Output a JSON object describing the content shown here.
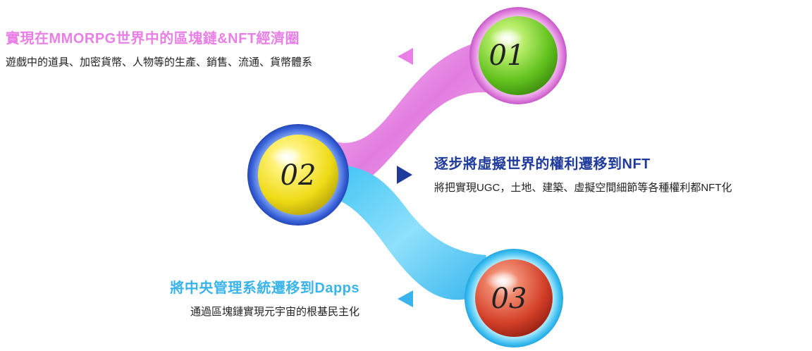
{
  "colors": {
    "pink": "#e97fe6",
    "navy": "#1e3a9c",
    "cyan": "#3ab4ec",
    "green": "#6ecb2a",
    "yellow": "#f2e21c",
    "red": "#d8402c"
  },
  "steps": [
    {
      "number": "01",
      "title": "實現在MMORPG世界中的區塊鏈&NFT經濟圈",
      "description": "遊戲中的道具、加密貨幣、人物等的生產、銷售、流通、貨幣體系"
    },
    {
      "number": "02",
      "title": "逐步將虛擬世界的權利遷移到NFT",
      "description": "將把實現UGC，土地、建築、虛擬空間細節等各種權利都NFT化"
    },
    {
      "number": "03",
      "title": "將中央管理系統遷移到Dapps",
      "description": "通過區塊鏈實現元宇宙的根基民主化"
    }
  ]
}
